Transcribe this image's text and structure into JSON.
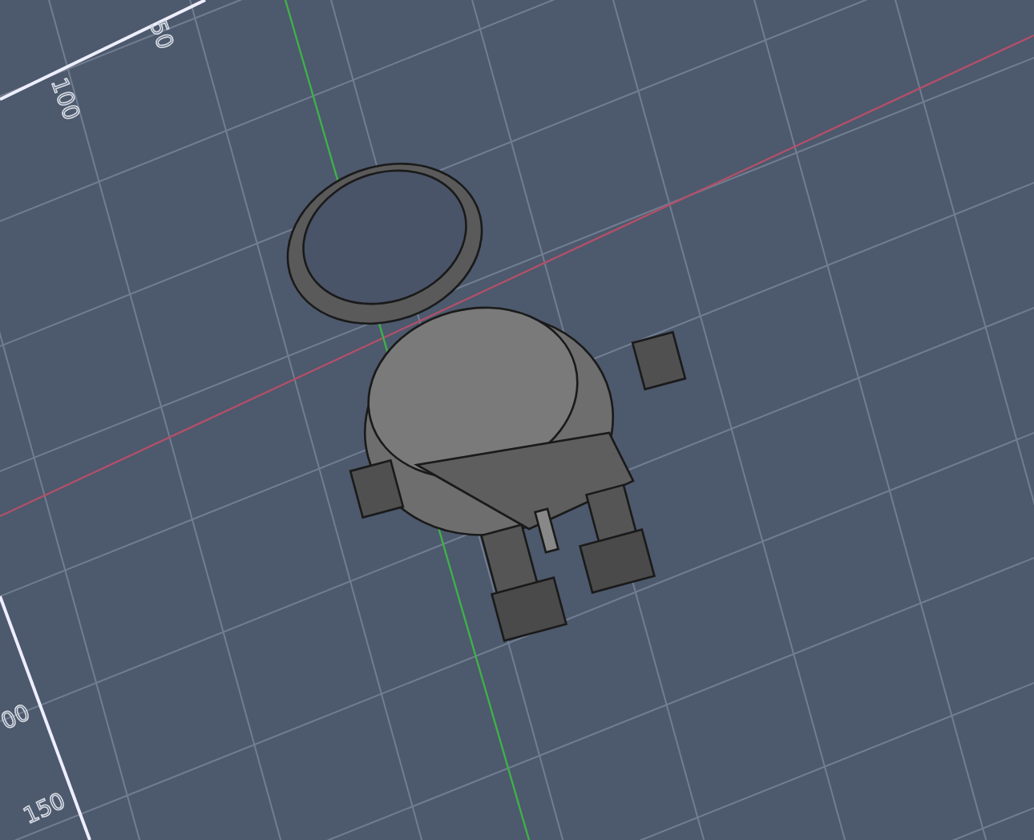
{
  "viewport": {
    "axis_labels": [
      {
        "text": "50"
      },
      {
        "text": "100"
      },
      {
        "text": "00"
      },
      {
        "text": "150"
      }
    ]
  }
}
